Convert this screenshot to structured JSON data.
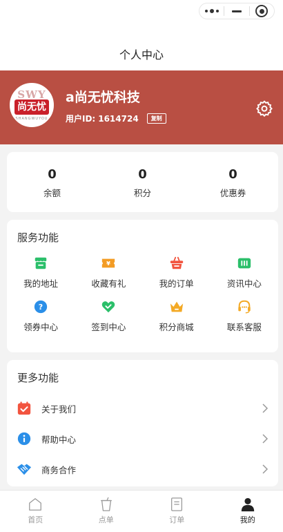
{
  "header": {
    "title": "个人中心"
  },
  "profile": {
    "name": "a尚无忧科技",
    "user_id_label": "用户ID:",
    "user_id": "1614724",
    "copy_label": "复制",
    "logo": {
      "top": "SWY",
      "main": "尚无忧",
      "sub": "SHANGWUYOU"
    }
  },
  "stats": [
    {
      "value": "0",
      "label": "余额"
    },
    {
      "value": "0",
      "label": "积分"
    },
    {
      "value": "0",
      "label": "优惠券"
    }
  ],
  "services": {
    "title": "服务功能",
    "items": [
      {
        "label": "我的地址",
        "icon": "shop-icon",
        "color": "#2bbf6a"
      },
      {
        "label": "收藏有礼",
        "icon": "coupon-icon",
        "color": "#f39c25"
      },
      {
        "label": "我的订单",
        "icon": "basket-icon",
        "color": "#f2543f"
      },
      {
        "label": "资讯中心",
        "icon": "news-icon",
        "color": "#2bbf6a"
      },
      {
        "label": "领券中心",
        "icon": "question-icon",
        "color": "#2b8fe8"
      },
      {
        "label": "签到中心",
        "icon": "heart-check-icon",
        "color": "#2bbf6a"
      },
      {
        "label": "积分商城",
        "icon": "crown-icon",
        "color": "#f3a925"
      },
      {
        "label": "联系客服",
        "icon": "headset-icon",
        "color": "#f3a925"
      }
    ]
  },
  "more": {
    "title": "更多功能",
    "items": [
      {
        "label": "关于我们",
        "icon": "calendar-check-icon",
        "color": "#f2543f"
      },
      {
        "label": "帮助中心",
        "icon": "info-icon",
        "color": "#2b8fe8"
      },
      {
        "label": "商务合作",
        "icon": "handshake-icon",
        "color": "#2b8fe8"
      }
    ]
  },
  "tabbar": [
    {
      "label": "首页",
      "active": false
    },
    {
      "label": "点单",
      "active": false
    },
    {
      "label": "订单",
      "active": false
    },
    {
      "label": "我的",
      "active": true
    }
  ]
}
